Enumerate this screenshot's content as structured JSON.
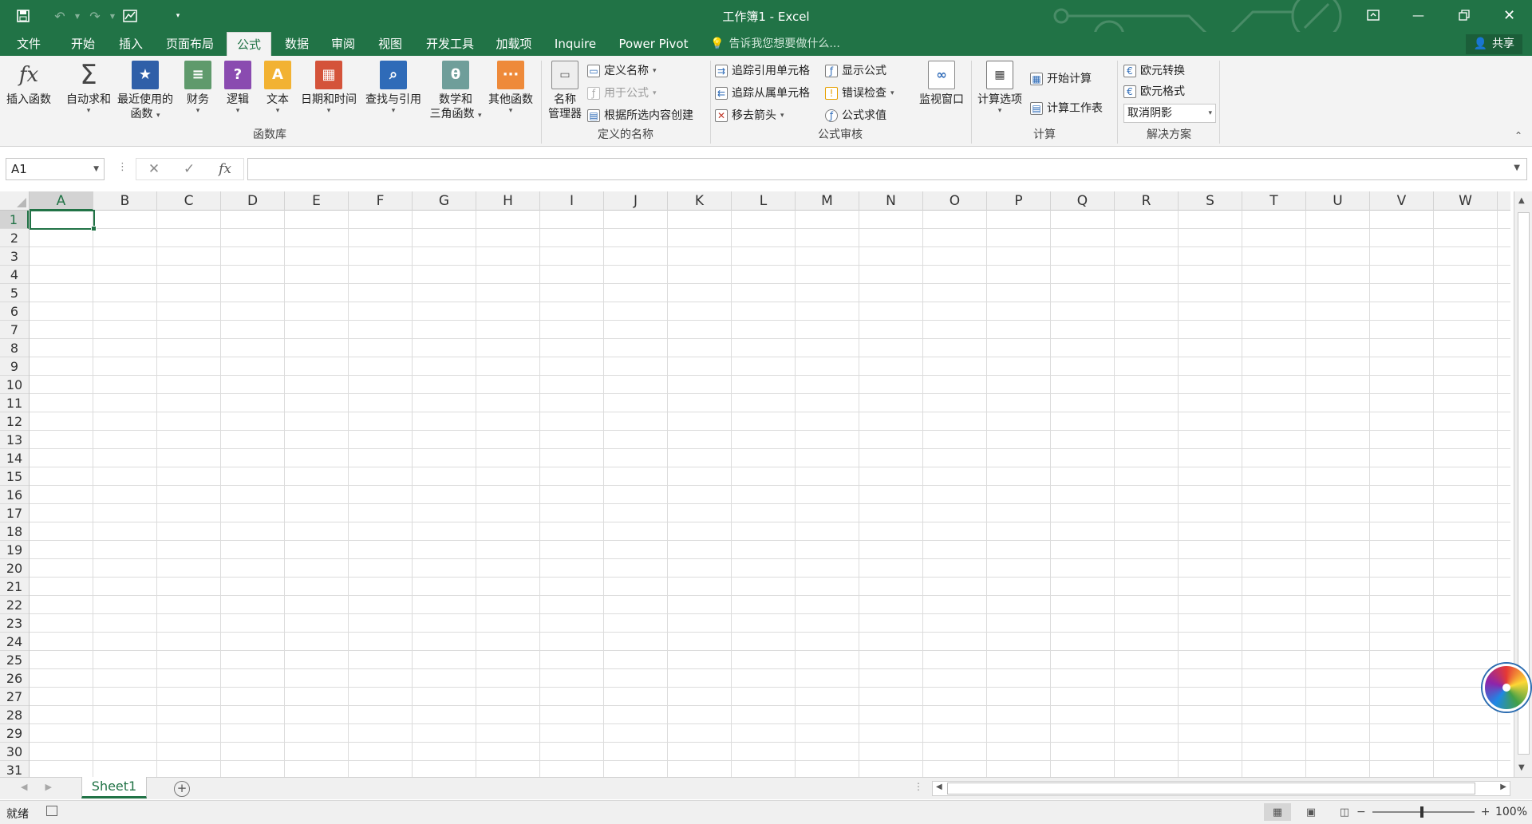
{
  "app": {
    "title": "工作簿1 - Excel",
    "accent_color": "#217346"
  },
  "qat": {
    "items": [
      "save-icon",
      "undo-icon",
      "redo-icon",
      "form-icon",
      "customize-icon"
    ]
  },
  "tabs": {
    "items": [
      "文件",
      "开始",
      "插入",
      "页面布局",
      "公式",
      "数据",
      "审阅",
      "视图",
      "开发工具",
      "加载项",
      "Inquire",
      "Power Pivot"
    ],
    "active": "公式",
    "tell_me": "告诉我您想要做什么...",
    "share": "共享"
  },
  "ribbon": {
    "function_library": {
      "label": "函数库",
      "insert_function": "插入函数",
      "autosum": "自动求和",
      "recent_1": "最近使用的",
      "recent_2": "函数",
      "financial": "财务",
      "logical": "逻辑",
      "text": "文本",
      "datetime": "日期和时间",
      "lookup": "查找与引用",
      "math_1": "数学和",
      "math_2": "三角函数",
      "more": "其他函数"
    },
    "defined_names": {
      "label": "定义的名称",
      "name_manager_1": "名称",
      "name_manager_2": "管理器",
      "define_name": "定义名称",
      "use_in_formula": "用于公式",
      "create_from_selection": "根据所选内容创建"
    },
    "formula_auditing": {
      "label": "公式审核",
      "trace_precedents": "追踪引用单元格",
      "trace_dependents": "追踪从属单元格",
      "remove_arrows": "移去箭头",
      "show_formulas": "显示公式",
      "error_checking": "错误检查",
      "evaluate_formula": "公式求值",
      "watch_window": "监视窗口"
    },
    "calculation": {
      "label": "计算",
      "options": "计算选项",
      "calc_now": "开始计算",
      "calc_sheet": "计算工作表"
    },
    "solutions": {
      "label": "解决方案",
      "euro_conversion": "欧元转换",
      "euro_format": "欧元格式",
      "shadow_value": "取消阴影"
    }
  },
  "formula_bar": {
    "name_box": "A1",
    "fx": "fx",
    "value": ""
  },
  "grid": {
    "columns": [
      "A",
      "B",
      "C",
      "D",
      "E",
      "F",
      "G",
      "H",
      "I",
      "J",
      "K",
      "L",
      "M",
      "N",
      "O",
      "P",
      "Q",
      "R",
      "S",
      "T",
      "U",
      "V",
      "W"
    ],
    "rows": [
      "1",
      "2",
      "3",
      "4",
      "5",
      "6",
      "7",
      "8",
      "9",
      "10",
      "11",
      "12",
      "13",
      "14",
      "15",
      "16",
      "17",
      "18",
      "19",
      "20",
      "21",
      "22",
      "23",
      "24",
      "25",
      "26",
      "27",
      "28",
      "29",
      "30",
      "31"
    ],
    "active_cell": "A1"
  },
  "sheets": {
    "items": [
      "Sheet1"
    ]
  },
  "status": {
    "ready": "就绪",
    "zoom": "100%"
  }
}
